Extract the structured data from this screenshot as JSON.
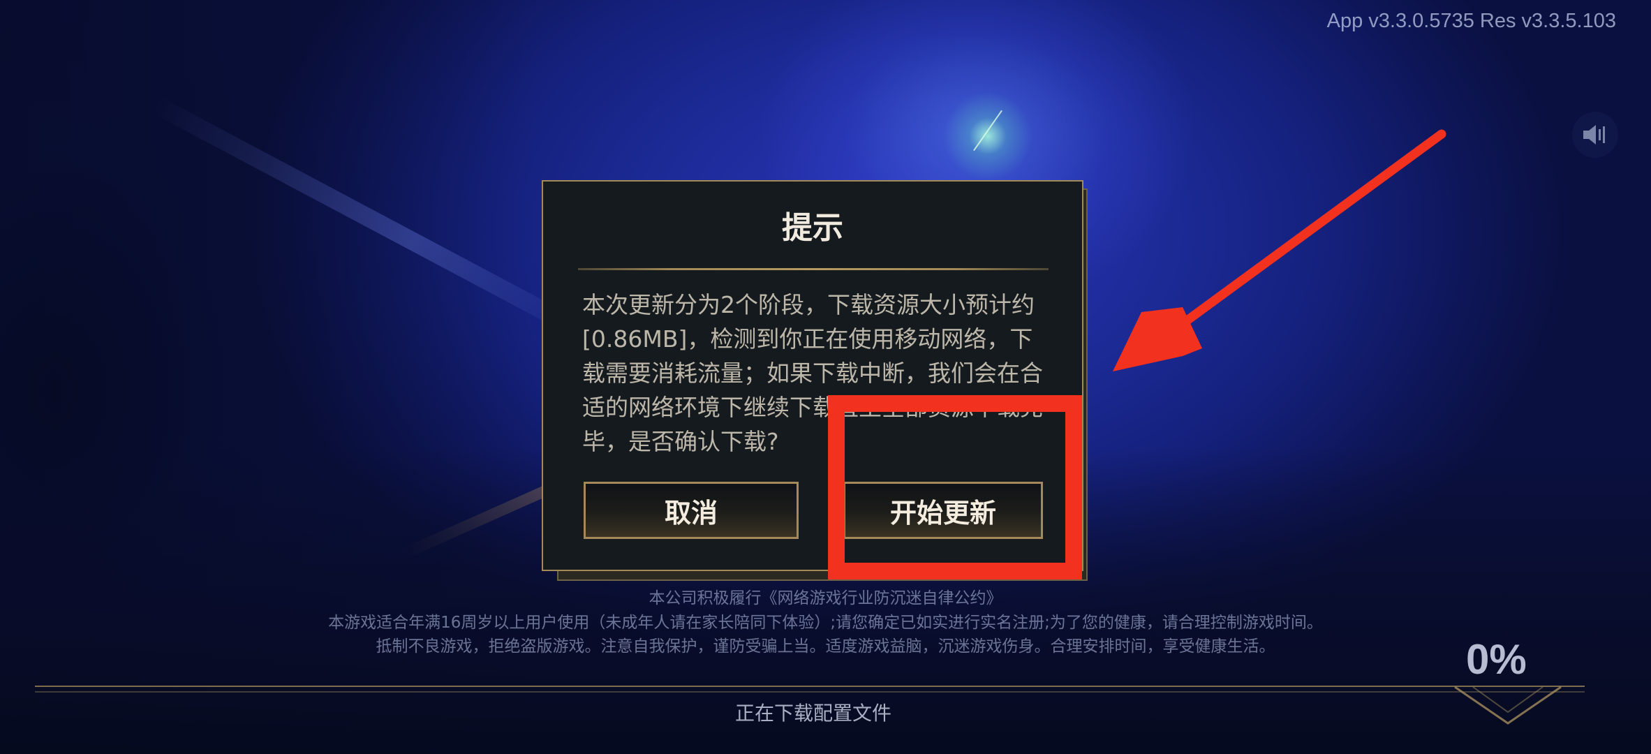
{
  "app": {
    "version_label": "App v3.3.0.5735 Res v3.3.5.103",
    "sound_icon": "speaker-icon"
  },
  "dialog": {
    "title": "提示",
    "message": "本次更新分为2个阶段，下载资源大小预计约[0.86MB]，检测到你正在使用移动网络，下载需要消耗流量；如果下载中断，我们会在合适的网络环境下继续下载直至全部资源下载完毕，是否确认下载?",
    "cancel_label": "取消",
    "confirm_label": "开始更新"
  },
  "notice": {
    "line1": "本公司积极履行《网络游戏行业防沉迷自律公约》",
    "line2": "本游戏适合年满16周岁以上用户使用（未成年人请在家长陪同下体验）;请您确定已如实进行实名注册;为了您的健康，请合理控制游戏时间。",
    "line3": "抵制不良游戏，拒绝盗版游戏。注意自我保护，谨防受骗上当。适度游戏益脑，沉迷游戏伤身。合理安排时间，享受健康生活。"
  },
  "progress": {
    "percent_label": "0%",
    "fraction": 0.0,
    "status": "正在下载配置文件"
  },
  "annotation": {
    "color": "#f3311f"
  }
}
